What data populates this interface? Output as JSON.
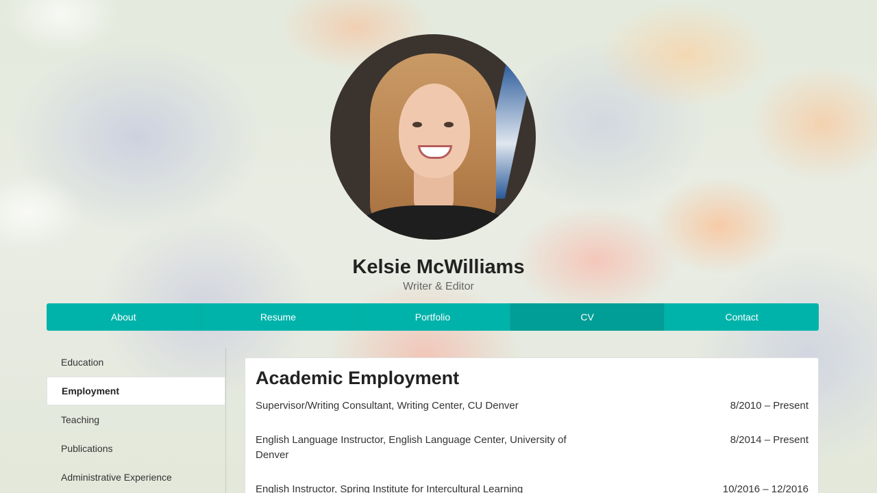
{
  "profile": {
    "name": "Kelsie McWilliams",
    "subtitle": "Writer & Editor"
  },
  "nav": {
    "items": [
      {
        "label": "About",
        "active": false
      },
      {
        "label": "Resume",
        "active": false
      },
      {
        "label": "Portfolio",
        "active": false
      },
      {
        "label": "CV",
        "active": true
      },
      {
        "label": "Contact",
        "active": false
      }
    ],
    "accent_color": "#00b3aa",
    "active_color": "#009e96"
  },
  "sidebar": {
    "items": [
      {
        "label": "Education",
        "active": false
      },
      {
        "label": "Employment",
        "active": true
      },
      {
        "label": "Teaching",
        "active": false
      },
      {
        "label": "Publications",
        "active": false
      },
      {
        "label": "Administrative Experience",
        "active": false
      }
    ]
  },
  "main": {
    "heading": "Academic Employment",
    "entries": [
      {
        "title": "Supervisor/Writing Consultant, Writing Center, CU Denver",
        "date": "8/2010 – Present"
      },
      {
        "title": "English Language Instructor, English Language Center, University of Denver",
        "date": "8/2014 – Present"
      },
      {
        "title": "English Instructor, Spring Institute for Intercultural Learning",
        "date": "10/2016 – 12/2016"
      }
    ]
  }
}
